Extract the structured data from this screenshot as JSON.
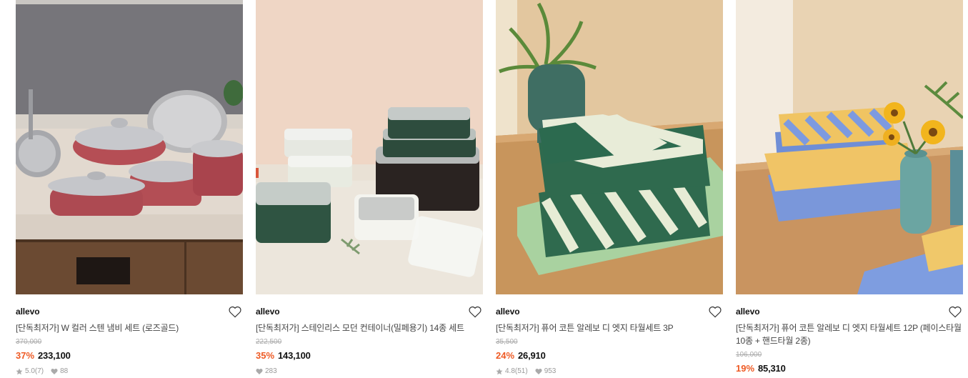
{
  "products": [
    {
      "brand": "allevo",
      "title": "[단독최저가] W 컬러 스텐 냄비 세트 (로즈골드)",
      "original_price": "370,000",
      "discount": "37%",
      "price": "233,100",
      "rating": "5.0(7)",
      "likes": "88",
      "image_icon": "cookware-photo"
    },
    {
      "brand": "allevo",
      "title": "[단독최저가] 스테인리스 모던 컨테이너(밀페용기) 14종 세트",
      "original_price": "222,500",
      "discount": "35%",
      "price": "143,100",
      "likes": "283",
      "image_icon": "container-photo"
    },
    {
      "brand": "allevo",
      "title": "[단독최저가] 퓨어 코튼 알레보 디 엣지 타월세트 3P",
      "original_price": "35,500",
      "discount": "24%",
      "price": "26,910",
      "rating": "4.8(51)",
      "likes": "953",
      "image_icon": "towel-green-photo"
    },
    {
      "brand": "allevo",
      "title": "[단독최저가] 퓨어 코튼 알레보 디 엣지 타월세트 12P (페이스타월 10종 + 핸드타월 2종)",
      "original_price": "106,000",
      "discount": "19%",
      "price": "85,310",
      "image_icon": "towel-blue-photo"
    }
  ],
  "colors": {
    "discount": "#ee5a24",
    "strike": "#aaaaaa",
    "meta": "#999999"
  },
  "icons": {
    "wish": "heart-outline-icon",
    "rating": "star-icon",
    "likes": "heart-filled-icon"
  }
}
